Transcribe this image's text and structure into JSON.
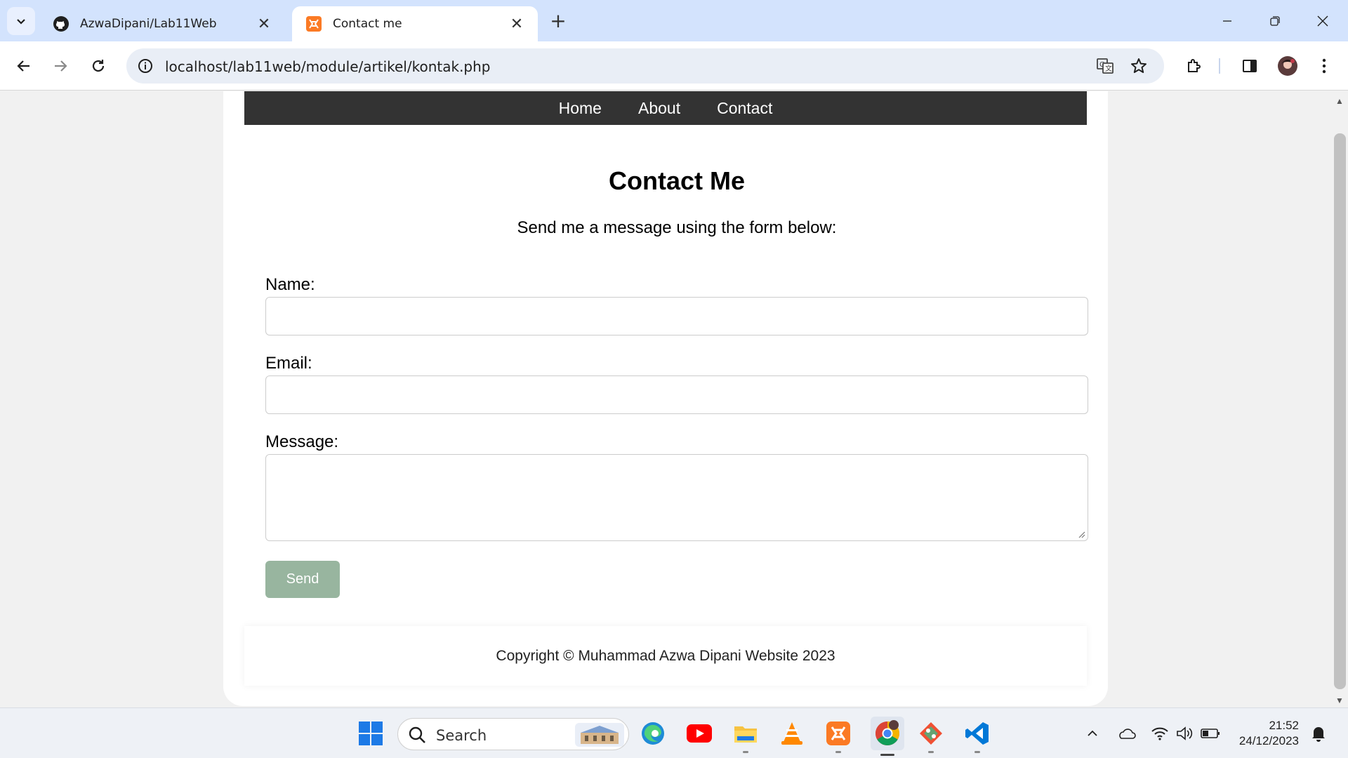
{
  "browser": {
    "tabs": [
      {
        "title": "AzwaDipani/Lab11Web",
        "favicon": "github-icon",
        "active": false
      },
      {
        "title": "Contact me",
        "favicon": "xampp-icon",
        "active": true
      }
    ],
    "url": "localhost/lab11web/module/artikel/kontak.php"
  },
  "nav": {
    "items": [
      "Home",
      "About",
      "Contact"
    ]
  },
  "page": {
    "title": "Contact Me",
    "subtitle": "Send me a message using the form below:"
  },
  "form": {
    "name_label": "Name:",
    "name_value": "",
    "email_label": "Email:",
    "email_value": "",
    "message_label": "Message:",
    "message_value": "",
    "send_label": "Send",
    "send_color": "#98b59f"
  },
  "footer": {
    "text": "Copyright © Muhammad Azwa Dipani Website 2023"
  },
  "taskbar": {
    "search_placeholder": "Search",
    "apps": [
      "windows-start-icon",
      "edge-icon",
      "youtube-icon",
      "file-explorer-icon",
      "vlc-icon",
      "xampp-icon",
      "chrome-icon",
      "git-icon",
      "vscode-icon"
    ],
    "time": "21:52",
    "date": "24/12/2023"
  },
  "colors": {
    "tabstrip": "#d3e3fd",
    "nav": "#333333",
    "page_bg": "#f1f1f1"
  }
}
